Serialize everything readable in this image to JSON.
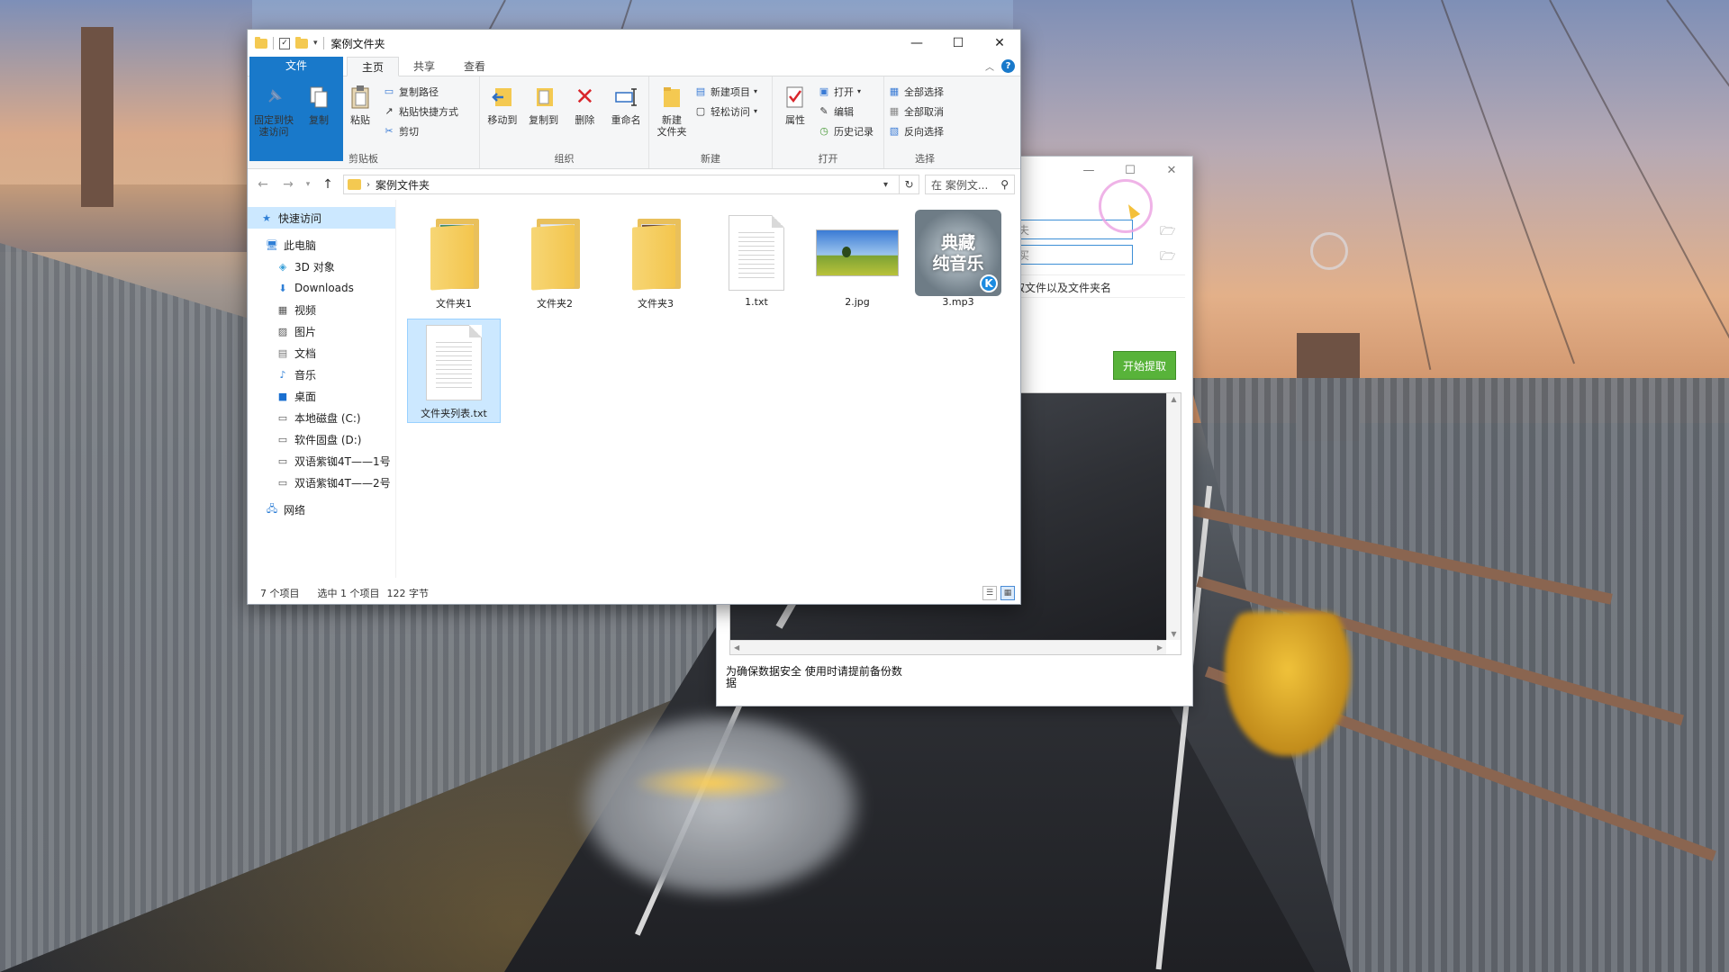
{
  "explorer": {
    "title": "案例文件夹",
    "tabs": {
      "file": "文件",
      "home": "主页",
      "share": "共享",
      "view": "查看"
    },
    "help": "?",
    "ribbon": {
      "clipboard": {
        "label": "剪贴板",
        "pin": "固定到快\n速访问",
        "copy": "复制",
        "paste": "粘贴",
        "copy_path": "复制路径",
        "paste_shortcut": "粘贴快捷方式",
        "cut": "剪切"
      },
      "organize": {
        "label": "组织",
        "move_to": "移动到",
        "copy_to": "复制到",
        "delete": "删除",
        "rename": "重命名"
      },
      "new": {
        "label": "新建",
        "new_folder": "新建\n文件夹",
        "new_item": "新建项目",
        "easy_access": "轻松访问"
      },
      "open": {
        "label": "打开",
        "properties": "属性",
        "open": "打开",
        "edit": "编辑",
        "history": "历史记录"
      },
      "select": {
        "label": "选择",
        "select_all": "全部选择",
        "select_none": "全部取消",
        "invert": "反向选择"
      }
    },
    "address": {
      "path": "案例文件夹"
    },
    "search": {
      "placeholder": "在 案例文..."
    },
    "nav": {
      "quick_access": "快速访问",
      "this_pc": "此电脑",
      "items": [
        "3D 对象",
        "Downloads",
        "视频",
        "图片",
        "文档",
        "音乐",
        "桌面",
        "本地磁盘 (C:)",
        "软件固盘 (D:)",
        "双语紫铷4T——1号",
        "双语紫铷4T——2号"
      ],
      "network": "网络"
    },
    "files": [
      {
        "name": "文件夹1",
        "type": "folder"
      },
      {
        "name": "文件夹2",
        "type": "folder"
      },
      {
        "name": "文件夹3",
        "type": "folder"
      },
      {
        "name": "1.txt",
        "type": "txt"
      },
      {
        "name": "2.jpg",
        "type": "jpg"
      },
      {
        "name": "3.mp3",
        "type": "mp3"
      },
      {
        "name": "文件夹列表.txt",
        "type": "txt",
        "selected": true
      }
    ],
    "mp3_cover_text": "典藏\n纯音乐",
    "mp3_badge": "K",
    "status": {
      "count": "7 个项目",
      "selection": "选中 1 个项目",
      "size": "122 字节"
    }
  },
  "tool": {
    "field1": "夫",
    "field2": "买",
    "option": "取文件以及文件夹名",
    "start_button": "开始提取",
    "notice": "为确保数据安全 使用时请提前备份数\n据"
  },
  "colors": {
    "accent": "#1979ca",
    "start_green": "#58b33a",
    "selection": "#cce8ff"
  }
}
